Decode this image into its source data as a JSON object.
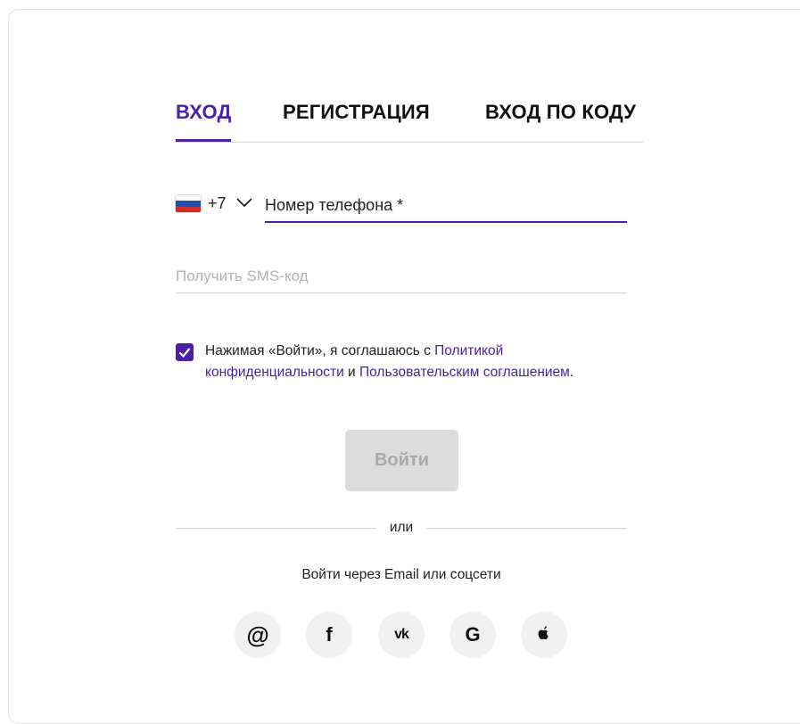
{
  "tabs": {
    "login": "ВХОД",
    "register": "РЕГИСТРАЦИЯ",
    "code_login": "ВХОД ПО КОДУ"
  },
  "phone": {
    "country_code": "+7",
    "placeholder": "Номер телефона *"
  },
  "sms": {
    "placeholder": "Получить SMS-код"
  },
  "agreement": {
    "text_prefix": "Нажимая «Войти», я соглашаюсь с ",
    "privacy_link": "Политикой конфиденциальности",
    "and": " и ",
    "terms_link": "Пользовательским соглашением",
    "suffix": "."
  },
  "login_button": "Войти",
  "divider_text": "или",
  "social": {
    "caption": "Войти через Email или соцсети",
    "email_glyph": "@",
    "facebook_glyph": "f",
    "vk_glyph": "vk",
    "google_glyph": "G"
  },
  "colors": {
    "accent": "#4b1fa6",
    "button_disabled_bg": "#dcdcdc",
    "button_disabled_text": "#a9a9a9"
  }
}
